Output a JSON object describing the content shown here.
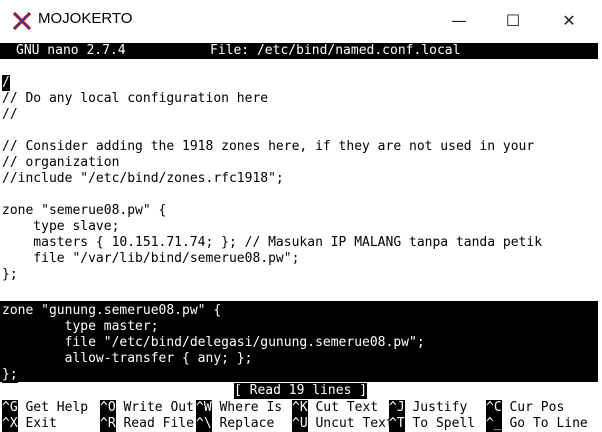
{
  "window": {
    "title": "MOJOKERTO",
    "minimize": "—",
    "maximize": "☐",
    "close": "✕"
  },
  "nano": {
    "version": "GNU nano 2.7.4",
    "file_label": "File: /etc/bind/named.conf.local"
  },
  "editor": {
    "cursor_char": "/",
    "lines": [
      "/",
      "// Do any local configuration here",
      "//",
      "",
      "// Consider adding the 1918 zones here, if they are not used in your",
      "// organization",
      "//include \"/etc/bind/zones.rfc1918\";",
      "",
      "zone \"semerue08.pw\" {",
      "    type slave;",
      "    masters { 10.151.71.74; }; // Masukan IP MALANG tanpa tanda petik",
      "    file \"/var/lib/bind/semerue08.pw\";",
      "};",
      "",
      "zone \"gunung.semerue08.pw\" {",
      "        type master;",
      "        file \"/etc/bind/delegasi/gunung.semerue08.pw\";",
      "        allow-transfer { any; };",
      "};"
    ]
  },
  "status": "[ Read 19 lines ]",
  "shortcuts": {
    "row1": [
      {
        "key": "^G",
        "label": "Get Help"
      },
      {
        "key": "^O",
        "label": "Write Out"
      },
      {
        "key": "^W",
        "label": "Where Is"
      },
      {
        "key": "^K",
        "label": "Cut Text"
      },
      {
        "key": "^J",
        "label": "Justify"
      },
      {
        "key": "^C",
        "label": "Cur Pos"
      }
    ],
    "row2": [
      {
        "key": "^X",
        "label": "Exit"
      },
      {
        "key": "^R",
        "label": "Read File"
      },
      {
        "key": "^\\",
        "label": "Replace"
      },
      {
        "key": "^U",
        "label": "Uncut Text"
      },
      {
        "key": "^T",
        "label": "To Spell"
      },
      {
        "key": "^_",
        "label": "Go To Line"
      }
    ]
  },
  "icons": {
    "app": "terminal-app-icon"
  }
}
